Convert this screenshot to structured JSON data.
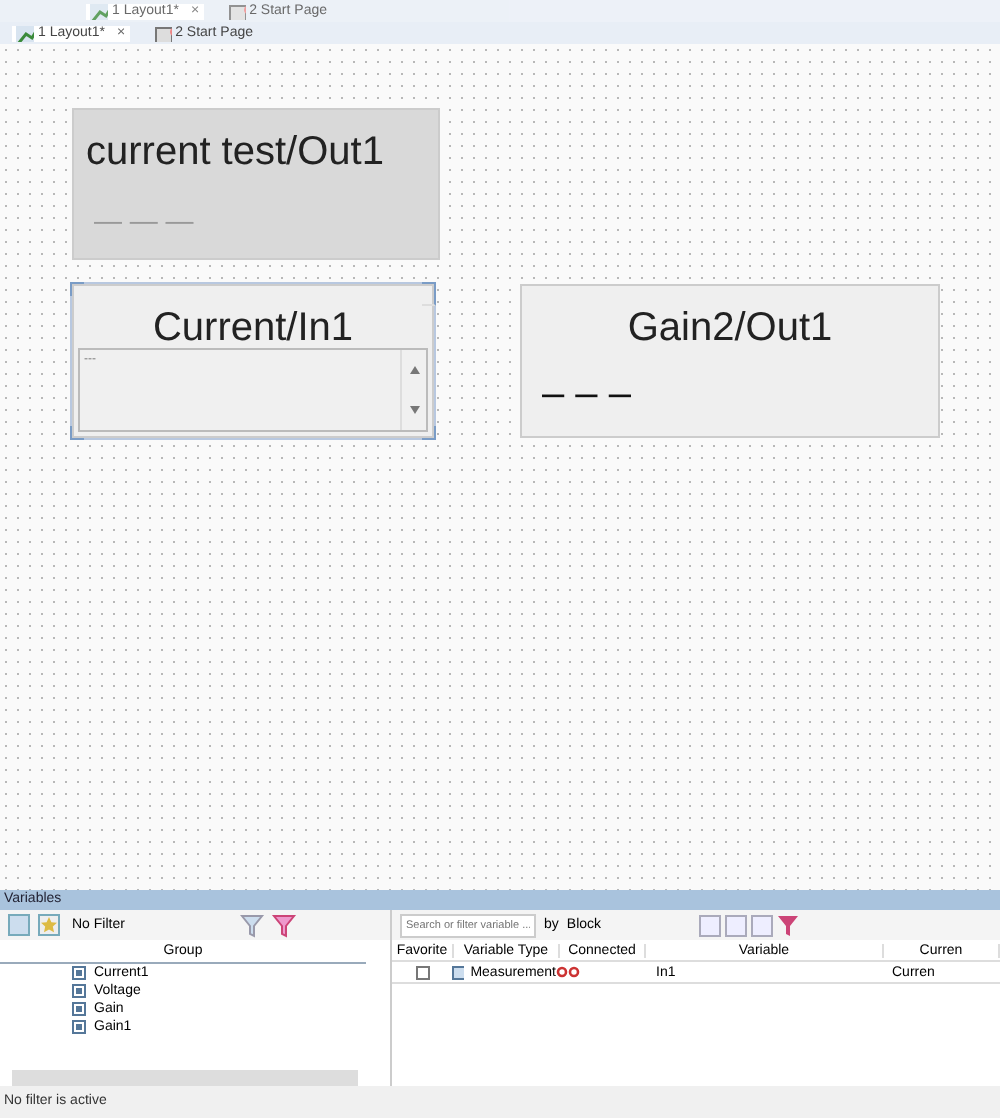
{
  "ghost_tabs": [
    {
      "label": "1 Layout1*",
      "selected": true,
      "close": "×"
    },
    {
      "label": "2 Start Page",
      "selected": false
    }
  ],
  "tabs": [
    {
      "label": "1 Layout1*",
      "selected": true,
      "close": "×"
    },
    {
      "label": "2 Start Page",
      "selected": false
    }
  ],
  "widgets": [
    {
      "kind": "display",
      "title": "current test/Out1",
      "value": "— — —",
      "selected": false,
      "dim": true
    },
    {
      "kind": "spin",
      "title": "Current/In1",
      "value": "---",
      "selected": true,
      "dim": false
    },
    {
      "kind": "display",
      "title": "Gain2/Out1",
      "value": "– – –",
      "selected": false,
      "dim": false
    }
  ],
  "variables": {
    "title": "Variables",
    "filter": "No Filter",
    "group_header": "Group",
    "groups": [
      {
        "name": "Current1"
      },
      {
        "name": "Voltage"
      },
      {
        "name": "Gain"
      },
      {
        "name": "Gain1"
      }
    ],
    "search": {
      "placeholder": "Search or filter variable ..."
    },
    "by_label": "by",
    "by_value": "Block",
    "columns": [
      "Favorite",
      "Variable Type",
      "Connected",
      "Variable",
      "Curren"
    ],
    "rows": [
      {
        "favorite": false,
        "type": "Measurement",
        "connected": true,
        "variable": "In1",
        "column_5": "Curren"
      }
    ]
  },
  "status_bar": "No filter is active"
}
